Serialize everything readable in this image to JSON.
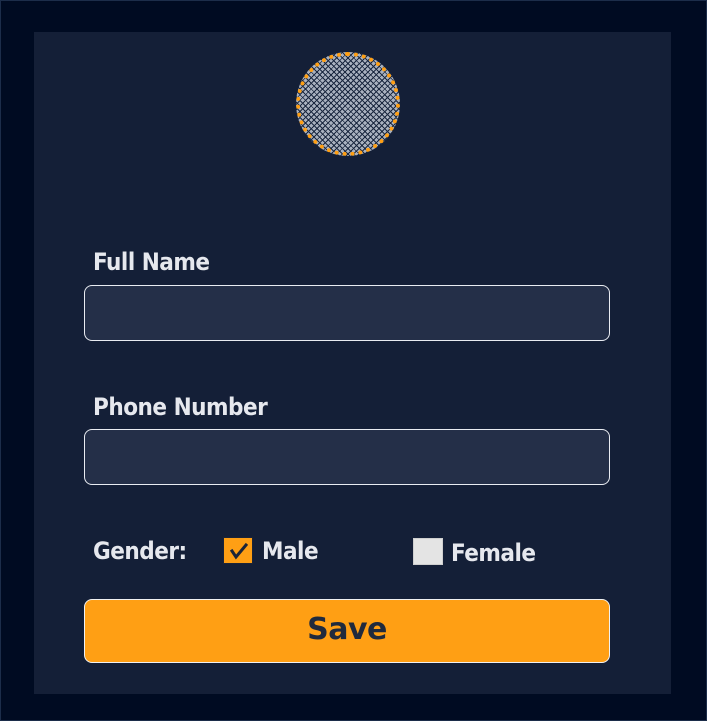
{
  "form": {
    "avatar_icon": "avatar-placeholder",
    "full_name": {
      "label": "Full Name",
      "value": "",
      "placeholder": ""
    },
    "phone_number": {
      "label": "Phone Number",
      "value": "",
      "placeholder": ""
    },
    "gender": {
      "label": "Gender:",
      "options": [
        {
          "label": "Male",
          "checked": true
        },
        {
          "label": "Female",
          "checked": false
        }
      ]
    },
    "save_label": "Save"
  },
  "colors": {
    "background": "#000b22",
    "card": "#141f37",
    "input_bg": "#242f48",
    "accent": "#ff9f14",
    "text": "#e6e8ee"
  }
}
